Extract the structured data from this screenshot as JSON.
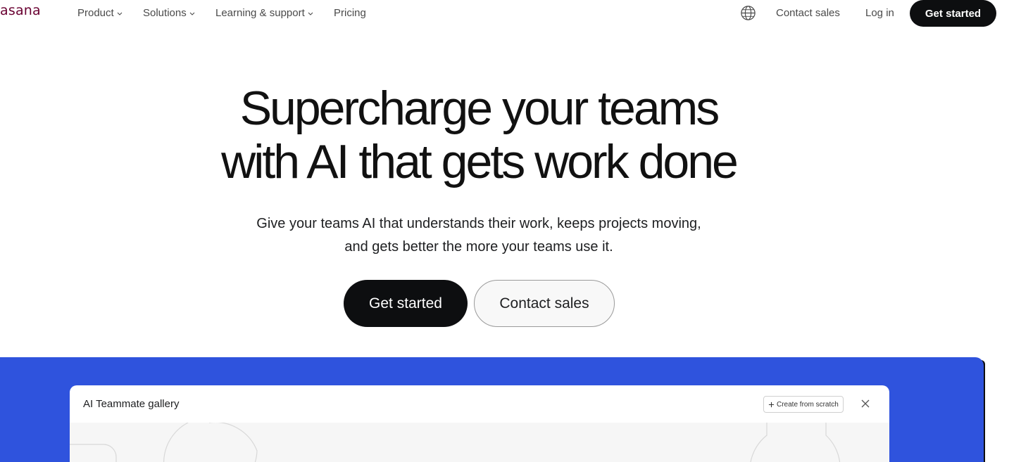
{
  "nav": {
    "logo": "asana",
    "items": [
      {
        "label": "Product"
      },
      {
        "label": "Solutions"
      },
      {
        "label": "Learning & support"
      },
      {
        "label": "Pricing"
      }
    ],
    "contact_sales": "Contact sales",
    "login": "Log in",
    "cta": "Get started"
  },
  "hero": {
    "title_line1": "Supercharge your teams",
    "title_line2": "with AI that gets work done",
    "subtitle_line1": "Give your teams AI that understands their work, keeps projects moving,",
    "subtitle_line2": "and gets better the more your teams use it.",
    "primary_button": "Get started",
    "secondary_button": "Contact sales"
  },
  "showcase": {
    "panel_title": "AI Teammate gallery",
    "create_button": "Create from scratch"
  },
  "colors": {
    "brand": "#690031",
    "primary_dark": "#0d0e10",
    "showcase_blue": "#2f53dd"
  },
  "icons": {
    "globe": "globe-icon",
    "chevron": "chevron-down-icon",
    "plus": "plus-icon",
    "close": "close-icon"
  }
}
